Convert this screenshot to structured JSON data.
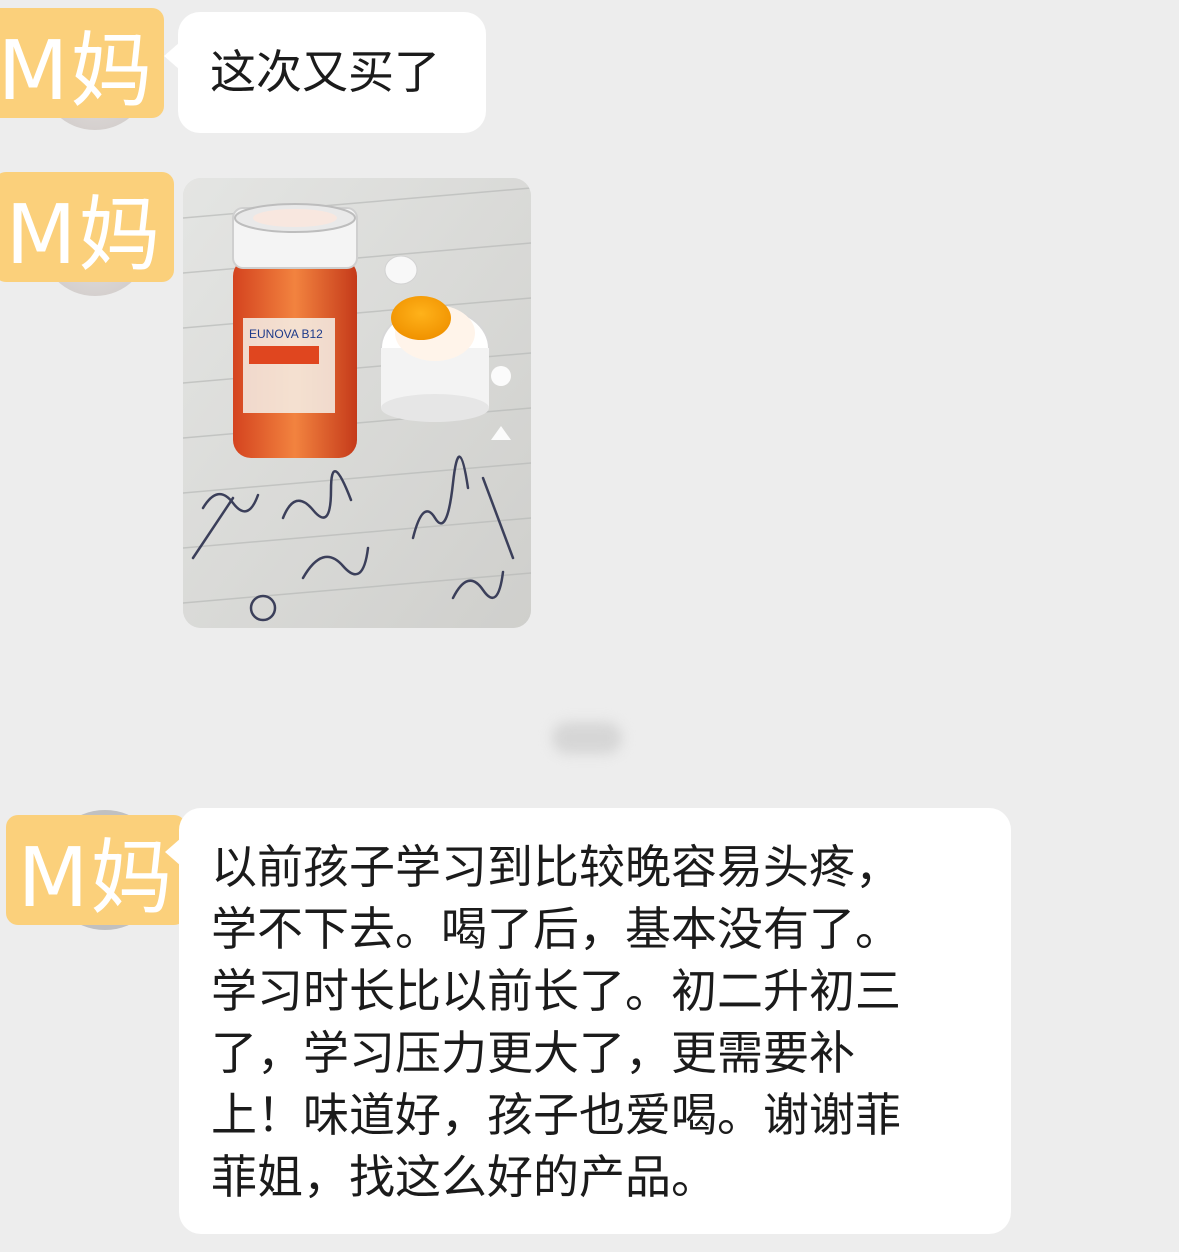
{
  "chat": {
    "sender_tag": "M妈",
    "messages": [
      {
        "type": "text",
        "text": "这次又买了"
      },
      {
        "type": "image",
        "icon": "medicine-bottle-photo",
        "label": "EUNOVA B12"
      },
      {
        "type": "text",
        "lines": [
          "以前孩子学习到比较晚容易头疼，",
          "学不下去。喝了后，基本没有了。",
          "学习时长比以前长了。初二升初三",
          "了，学习压力更大了，更需要补",
          "上！味道好，孩子也爱喝。谢谢菲",
          "菲姐，找这么好的产品。"
        ]
      }
    ]
  },
  "colors": {
    "background": "#ededed",
    "bubble": "#ffffff",
    "tag": "#fbd07b",
    "text": "#1b1b1b"
  }
}
